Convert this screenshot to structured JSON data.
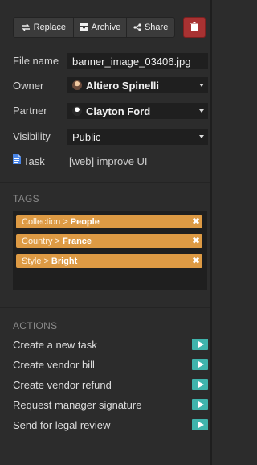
{
  "toolbar": {
    "replace_label": "Replace",
    "archive_label": "Archive",
    "share_label": "Share"
  },
  "fields": {
    "file_name": {
      "label": "File name",
      "value": "banner_image_03406.jpg"
    },
    "owner": {
      "label": "Owner",
      "value": "Altiero Spinelli"
    },
    "partner": {
      "label": "Partner",
      "value": "Clayton Ford"
    },
    "visibility": {
      "label": "Visibility",
      "value": "Public"
    },
    "task": {
      "label": "Task",
      "value": "[web] improve UI"
    }
  },
  "tags": {
    "title": "TAGS",
    "items": [
      {
        "category": "Collection",
        "sep": ">",
        "value": "People"
      },
      {
        "category": "Country",
        "sep": ">",
        "value": "France"
      },
      {
        "category": "Style",
        "sep": ">",
        "value": "Bright"
      }
    ],
    "remove_glyph": "✖"
  },
  "actions": {
    "title": "ACTIONS",
    "items": [
      "Create a new task",
      "Create vendor bill",
      "Create vendor refund",
      "Request manager signature",
      "Send for legal review"
    ]
  },
  "colors": {
    "background": "#2c2c2c",
    "tag": "#dd9a44",
    "delete": "#a83232",
    "action_play": "#3fb4ac",
    "task_icon": "#4a86e8"
  }
}
